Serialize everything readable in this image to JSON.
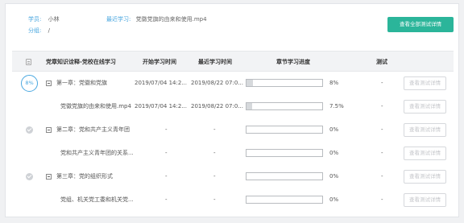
{
  "header": {
    "student_label": "学员:",
    "student_name": "小林",
    "recent_label": "最近学习:",
    "recent_file": "党徽党旗的由来和使用.mp4",
    "group_label": "分组:",
    "group_value": "/",
    "view_all_button": "查看全部测试详情"
  },
  "table": {
    "columns": [
      "党章知识诠释-党校在线学习",
      "开始学习时间",
      "最近学习时间",
      "章节学习进度",
      "测试"
    ],
    "rows": [
      {
        "status": "8%",
        "toggle": true,
        "title": "第一章：党徽和党旗",
        "start": "2019/07/04 14:2...",
        "recent": "2019/08/22 07:0...",
        "progress": 0.08,
        "progress_text": "8%",
        "test": "-",
        "button": "查看测试详情"
      },
      {
        "title": "党徽党旗的由来和使用.mp4",
        "start": "2019/07/04 14:2...",
        "recent": "2019/08/22 07:0...",
        "progress": 0.075,
        "progress_text": "7.5%",
        "test": "-",
        "button": "查看测试详情"
      },
      {
        "status": "check",
        "toggle": true,
        "title": "第二章：党和共产主义青年团",
        "start": "-",
        "recent": "-",
        "progress": 0,
        "progress_text": "0%",
        "test": "-",
        "button": "查看测试详情"
      },
      {
        "title": "党和共产主义青年团的关系...",
        "start": "-",
        "recent": "-",
        "progress": 0,
        "progress_text": "0%",
        "test": "-",
        "button": "查看测试详情"
      },
      {
        "status": "check",
        "toggle": true,
        "title": "第三章：党的组织形式",
        "start": "-",
        "recent": "-",
        "progress": 0,
        "progress_text": "0%",
        "test": "-",
        "button": "查看测试详情"
      },
      {
        "title": "党组、机关党工委和机关党...",
        "start": "-",
        "recent": "-",
        "progress": 0,
        "progress_text": "0%",
        "test": "-",
        "button": "查看测试详情"
      }
    ]
  }
}
